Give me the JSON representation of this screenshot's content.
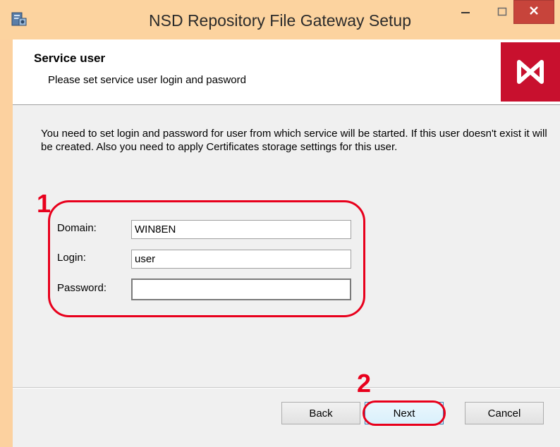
{
  "window": {
    "title": "NSD Repository File Gateway Setup",
    "icons": {
      "app": "installer-icon",
      "minimize": "minimize-icon",
      "maximize": "maximize-icon",
      "close": "close-icon"
    }
  },
  "header": {
    "title": "Service user",
    "subtitle": "Please set service user login and pasword",
    "logo_icon": "nsd-logo-icon",
    "logo_color": "#c8102e"
  },
  "body": {
    "description": "You need to set login and password for user from which service will be started. If this user doesn't exist it will be created. Also you need to apply Certificates storage settings for this user."
  },
  "form": {
    "domain": {
      "label": "Domain:",
      "value": "WIN8EN"
    },
    "login": {
      "label": "Login:",
      "value": "user"
    },
    "password": {
      "label": "Password:",
      "value": ""
    }
  },
  "annotations": {
    "step1": "1",
    "step2": "2",
    "color": "#e8001c"
  },
  "buttons": {
    "back": "Back",
    "next": "Next",
    "cancel": "Cancel"
  }
}
